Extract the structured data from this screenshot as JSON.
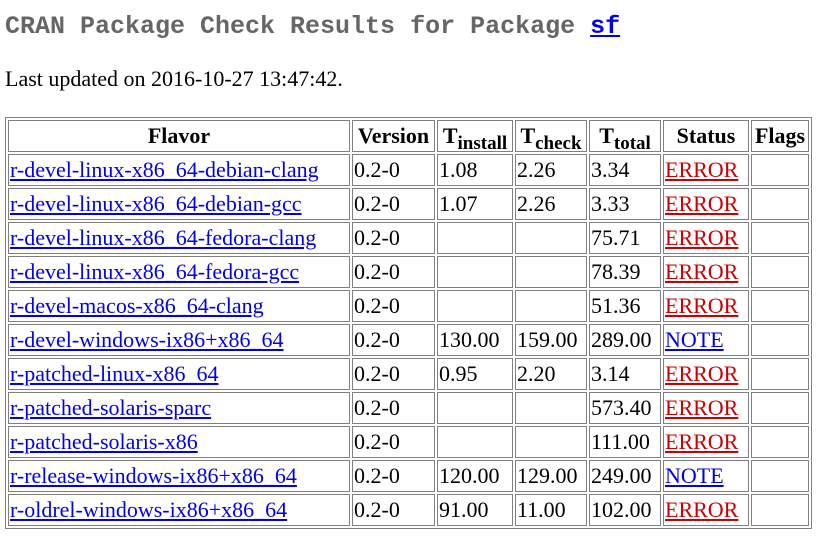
{
  "header": {
    "title_prefix": "CRAN Package Check Results for Package ",
    "package_name": "sf"
  },
  "last_updated": "Last updated on 2016-10-27 13:47:42.",
  "table": {
    "columns": {
      "flavor": "Flavor",
      "version": "Version",
      "tinstall_T": "T",
      "tinstall_sub": "install",
      "tcheck_T": "T",
      "tcheck_sub": "check",
      "ttotal_T": "T",
      "ttotal_sub": "total",
      "status": "Status",
      "flags": "Flags"
    },
    "rows": [
      {
        "flavor": "r-devel-linux-x86_64-debian-clang",
        "version": "0.2-0",
        "tinstall": "1.08",
        "tcheck": "2.26",
        "ttotal": "3.34",
        "status": "ERROR",
        "status_type": "error",
        "flags": ""
      },
      {
        "flavor": "r-devel-linux-x86_64-debian-gcc",
        "version": "0.2-0",
        "tinstall": "1.07",
        "tcheck": "2.26",
        "ttotal": "3.33",
        "status": "ERROR",
        "status_type": "error",
        "flags": ""
      },
      {
        "flavor": "r-devel-linux-x86_64-fedora-clang",
        "version": "0.2-0",
        "tinstall": "",
        "tcheck": "",
        "ttotal": "75.71",
        "status": "ERROR",
        "status_type": "error",
        "flags": ""
      },
      {
        "flavor": "r-devel-linux-x86_64-fedora-gcc",
        "version": "0.2-0",
        "tinstall": "",
        "tcheck": "",
        "ttotal": "78.39",
        "status": "ERROR",
        "status_type": "error",
        "flags": ""
      },
      {
        "flavor": "r-devel-macos-x86_64-clang",
        "version": "0.2-0",
        "tinstall": "",
        "tcheck": "",
        "ttotal": "51.36",
        "status": "ERROR",
        "status_type": "error",
        "flags": ""
      },
      {
        "flavor": "r-devel-windows-ix86+x86_64",
        "version": "0.2-0",
        "tinstall": "130.00",
        "tcheck": "159.00",
        "ttotal": "289.00",
        "status": "NOTE",
        "status_type": "note",
        "flags": ""
      },
      {
        "flavor": "r-patched-linux-x86_64",
        "version": "0.2-0",
        "tinstall": "0.95",
        "tcheck": "2.20",
        "ttotal": "3.14",
        "status": "ERROR",
        "status_type": "error",
        "flags": ""
      },
      {
        "flavor": "r-patched-solaris-sparc",
        "version": "0.2-0",
        "tinstall": "",
        "tcheck": "",
        "ttotal": "573.40",
        "status": "ERROR",
        "status_type": "error",
        "flags": ""
      },
      {
        "flavor": "r-patched-solaris-x86",
        "version": "0.2-0",
        "tinstall": "",
        "tcheck": "",
        "ttotal": "111.00",
        "status": "ERROR",
        "status_type": "error",
        "flags": ""
      },
      {
        "flavor": "r-release-windows-ix86+x86_64",
        "version": "0.2-0",
        "tinstall": "120.00",
        "tcheck": "129.00",
        "ttotal": "249.00",
        "status": "NOTE",
        "status_type": "note",
        "flags": ""
      },
      {
        "flavor": "r-oldrel-windows-ix86+x86_64",
        "version": "0.2-0",
        "tinstall": "91.00",
        "tcheck": "11.00",
        "ttotal": "102.00",
        "status": "ERROR",
        "status_type": "error",
        "flags": ""
      }
    ]
  },
  "colors": {
    "title_gray": "#666666",
    "link_blue": "#0000ee",
    "error_red": "#cc0000",
    "border_gray": "#808080"
  }
}
